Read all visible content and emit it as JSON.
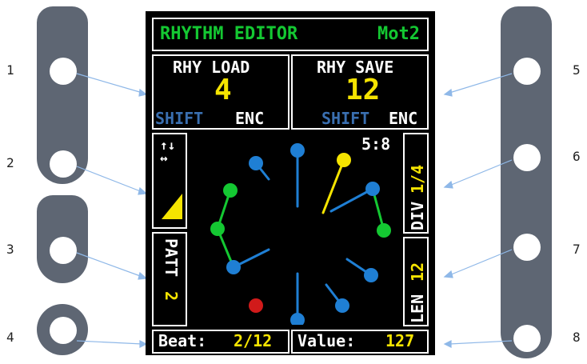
{
  "left_labels": [
    "1",
    "2",
    "3",
    "4"
  ],
  "right_labels": [
    "5",
    "6",
    "7",
    "8"
  ],
  "screen": {
    "title": "RHYTHM EDITOR",
    "mode": "Mot2",
    "load": {
      "label": "RHY LOAD",
      "value": "4",
      "shift": "SHIFT",
      "enc": "ENC"
    },
    "save": {
      "label": "RHY SAVE",
      "value": "12",
      "shift": "SHIFT",
      "enc": "ENC"
    },
    "arrows": "↑↓↔",
    "patt": {
      "label": "PATT",
      "value": "2"
    },
    "ratio": "5:8",
    "div": {
      "label": "DIV",
      "value": "1/4"
    },
    "len": {
      "label": "LEN",
      "value": "12"
    },
    "beat": {
      "label": "Beat:",
      "value": "2/12"
    },
    "val": {
      "label": "Value:",
      "value": "127"
    }
  },
  "colors": {
    "yellow": "#f5e400",
    "green": "#14c832",
    "blue": "#1f7fd4",
    "red": "#d11a1a",
    "paddle": "#5e6673"
  }
}
